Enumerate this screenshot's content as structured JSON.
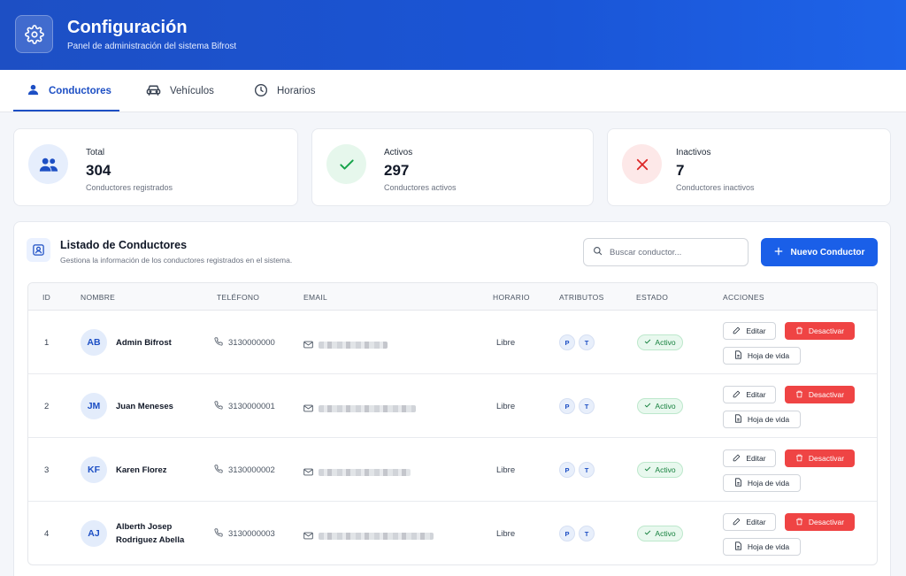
{
  "header": {
    "title": "Configuración",
    "subtitle": "Panel de administración del sistema Bifrost",
    "icon": "gear-icon"
  },
  "tabs": [
    {
      "label": "Conductores",
      "icon": "user-icon",
      "active": true
    },
    {
      "label": "Vehículos",
      "icon": "car-icon",
      "active": false
    },
    {
      "label": "Horarios",
      "icon": "clock-icon",
      "active": false
    }
  ],
  "stats": [
    {
      "label": "Total",
      "value": "304",
      "desc": "Conductores registrados",
      "icon": "users-icon",
      "color": "#1d4fc4"
    },
    {
      "label": "Activos",
      "value": "297",
      "desc": "Conductores activos",
      "icon": "check-icon",
      "color": "#16a34a"
    },
    {
      "label": "Inactivos",
      "value": "7",
      "desc": "Conductores inactivos",
      "icon": "x-icon",
      "color": "#dc2626"
    }
  ],
  "list": {
    "title": "Listado de Conductores",
    "subtitle": "Gestiona la información de los conductores registrados en el sistema.",
    "search_placeholder": "Buscar conductor...",
    "new_button": "Nuevo Conductor"
  },
  "table": {
    "columns": [
      "ID",
      "NOMBRE",
      "TELÉFONO",
      "EMAIL",
      "HORARIO",
      "ATRIBUTOS",
      "ESTADO",
      "ACCIONES"
    ],
    "rows": [
      {
        "id": "1",
        "initials": "AB",
        "name": "Admin Bifrost",
        "phone": "3130000000",
        "schedule": "Libre",
        "attrs": [
          "P",
          "T"
        ],
        "status": "Activo"
      },
      {
        "id": "2",
        "initials": "JM",
        "name": "Juan Meneses",
        "phone": "3130000001",
        "schedule": "Libre",
        "attrs": [
          "P",
          "T"
        ],
        "status": "Activo"
      },
      {
        "id": "3",
        "initials": "KF",
        "name": "Karen Florez",
        "phone": "3130000002",
        "schedule": "Libre",
        "attrs": [
          "P",
          "T"
        ],
        "status": "Activo"
      },
      {
        "id": "4",
        "initials": "AJ",
        "name": "Alberth Josep Rodriguez Abella",
        "phone": "3130000003",
        "schedule": "Libre",
        "attrs": [
          "P",
          "T"
        ],
        "status": "Activo"
      }
    ],
    "actions": {
      "edit": "Editar",
      "deactivate": "Desactivar",
      "cv": "Hoja de vida"
    }
  },
  "colors": {
    "primary": "#1d4fc4",
    "accent": "#1a5fe8",
    "danger": "#ef4444",
    "success": "#15803d"
  }
}
